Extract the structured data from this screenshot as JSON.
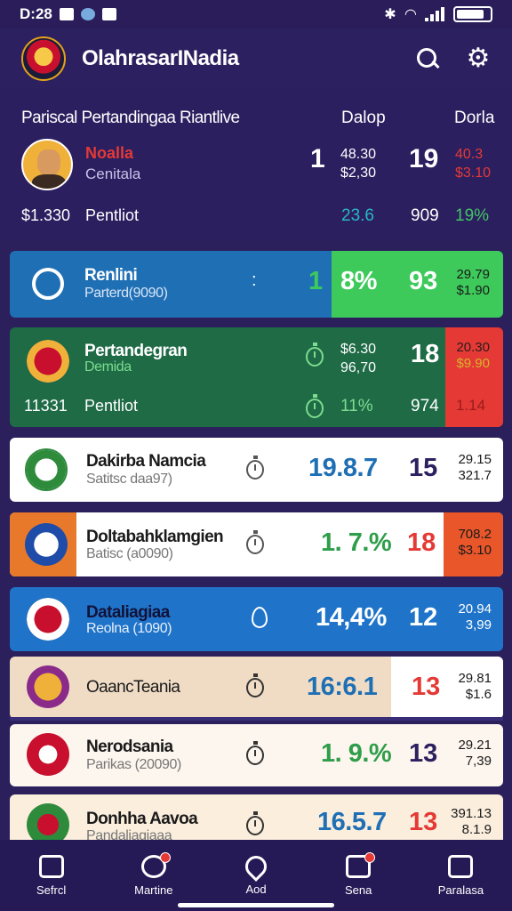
{
  "status": {
    "time": "D:28",
    "icons": [
      "notification-icon",
      "circle-icon",
      "home-icon"
    ],
    "right_icons": [
      "bluetooth-icon",
      "wifi-icon",
      "signal-icon",
      "battery-icon"
    ]
  },
  "appbar": {
    "title": "OlahrasarINadia"
  },
  "hero": {
    "header": "Pariscal Pertandingaa Riantlive",
    "col1": "Dalop",
    "col2": "Dorla",
    "player_name": "Noalla",
    "player_sub": "Cenitala",
    "score_left": "1",
    "odds_a": [
      "48.30",
      "$2,30"
    ],
    "score_right": "19",
    "odds_b": [
      "40.3",
      "$3.10"
    ],
    "price": "$1.330",
    "price_label": "Pentliot",
    "stat1": "23.6",
    "stat2": "909",
    "stat3": "19%"
  },
  "cards": [
    {
      "name": "Renlini",
      "sub": "Parterd(9090)",
      "pct": "8%",
      "num1": "1",
      "num2": "93",
      "s1": "29.79",
      "s2": "$1.90"
    },
    {
      "name": "Pertandegran",
      "sub": "Demida",
      "price": "11331",
      "price_label": "Pentliot",
      "pct_a": [
        "$6.30",
        "96,70"
      ],
      "num": "18",
      "pct": "11%",
      "num2": "974",
      "s1": "20.30",
      "s2": "$9.90",
      "s3": "1.14"
    },
    {
      "name": "Dakirba Namcia",
      "sub": "Satitsc daa97)",
      "pct": "19.8.7",
      "num": "15",
      "s1": "29.15",
      "s2": "321.7"
    },
    {
      "name": "Doltabahklamgien",
      "sub": "Batisc (a0090)",
      "pct": "1. 7.%",
      "num": "18",
      "s1": "708.2",
      "s2": "$3.10"
    },
    {
      "name": "Dataliagiaa",
      "sub": "Reolna (1090)",
      "pct": "14,4%",
      "num": "12",
      "s1": "20.94",
      "s2": "3,99"
    },
    {
      "name": "OaancTeania",
      "pct": "16:6.1",
      "num": "13",
      "s1": "29.81",
      "s2": "$1.6"
    },
    {
      "name": "Nerodsania",
      "sub": "Parikas (20090)",
      "pct": "1. 9.%",
      "num": "13",
      "s1": "29.21",
      "s2": "7,39"
    },
    {
      "name": "Donhha Aavoa",
      "sub": "Pandaliagiaaa",
      "pct": "16.5.7",
      "num": "13",
      "s1": "391.13",
      "s2": "8.1.9"
    }
  ],
  "nav": [
    {
      "label": "Sefrcl",
      "icon": "home-icon"
    },
    {
      "label": "Martine",
      "icon": "trophy-icon"
    },
    {
      "label": "Aod",
      "icon": "location-icon"
    },
    {
      "label": "Sena",
      "icon": "chart-icon"
    },
    {
      "label": "Paralasa",
      "icon": "profile-icon"
    }
  ]
}
